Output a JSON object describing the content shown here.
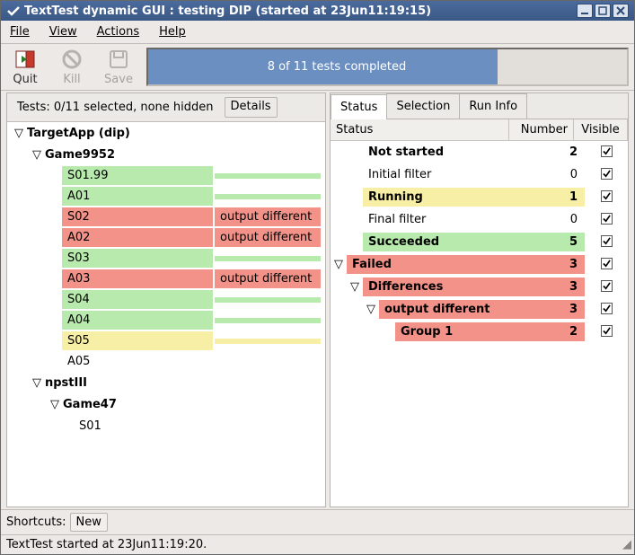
{
  "window": {
    "title": "TextTest dynamic GUI : testing DIP (started at 23Jun11:19:15)"
  },
  "menu": {
    "file": "File",
    "view": "View",
    "actions": "Actions",
    "help": "Help"
  },
  "toolbar": {
    "quit": "Quit",
    "kill": "Kill",
    "save": "Save"
  },
  "progress": {
    "pct": 73,
    "label": "8 of 11 tests completed"
  },
  "left": {
    "info": "Tests: 0/11 selected, none hidden",
    "details_btn": "Details",
    "root": "TargetApp (dip)",
    "suite1": "Game9952",
    "suite2": "npstIII",
    "suite3": "Game47",
    "tests": [
      {
        "name": "S01.99",
        "msg": "",
        "cls": "green"
      },
      {
        "name": "A01",
        "msg": "",
        "cls": "green"
      },
      {
        "name": "S02",
        "msg": "output different",
        "cls": "red"
      },
      {
        "name": "A02",
        "msg": "output different",
        "cls": "red"
      },
      {
        "name": "S03",
        "msg": "",
        "cls": "green"
      },
      {
        "name": "A03",
        "msg": "output different",
        "cls": "red"
      },
      {
        "name": "S04",
        "msg": "",
        "cls": "green"
      },
      {
        "name": "A04",
        "msg": "",
        "cls": "green"
      },
      {
        "name": "S05",
        "msg": "",
        "cls": "yellow"
      },
      {
        "name": "A05",
        "msg": "",
        "cls": ""
      }
    ],
    "suite3_test": "S01"
  },
  "tabs": {
    "status": "Status",
    "selection": "Selection",
    "runinfo": "Run Info"
  },
  "table": {
    "h_status": "Status",
    "h_number": "Number",
    "h_visible": "Visible"
  },
  "status_rows": [
    {
      "indent": 1,
      "tw": "",
      "label": "Not started",
      "num": "2",
      "cls": "",
      "bold": true
    },
    {
      "indent": 1,
      "tw": "",
      "label": "Initial filter",
      "num": "0",
      "cls": "",
      "bold": false
    },
    {
      "indent": 1,
      "tw": "",
      "label": "Running",
      "num": "1",
      "cls": "yellow",
      "bold": true
    },
    {
      "indent": 1,
      "tw": "",
      "label": "Final filter",
      "num": "0",
      "cls": "",
      "bold": false
    },
    {
      "indent": 1,
      "tw": "",
      "label": "Succeeded",
      "num": "5",
      "cls": "green",
      "bold": true
    },
    {
      "indent": 0,
      "tw": "▽",
      "label": "Failed",
      "num": "3",
      "cls": "red",
      "bold": true
    },
    {
      "indent": 1,
      "tw": "▽",
      "label": "Differences",
      "num": "3",
      "cls": "red",
      "bold": true
    },
    {
      "indent": 2,
      "tw": "▽",
      "label": "output different",
      "num": "3",
      "cls": "red",
      "bold": true
    },
    {
      "indent": 3,
      "tw": "",
      "label": "Group 1",
      "num": "2",
      "cls": "red",
      "bold": true
    }
  ],
  "shortcuts": {
    "label": "Shortcuts:",
    "new_btn": "New"
  },
  "statusbar": {
    "text": "TextTest started at 23Jun11:19:20."
  }
}
